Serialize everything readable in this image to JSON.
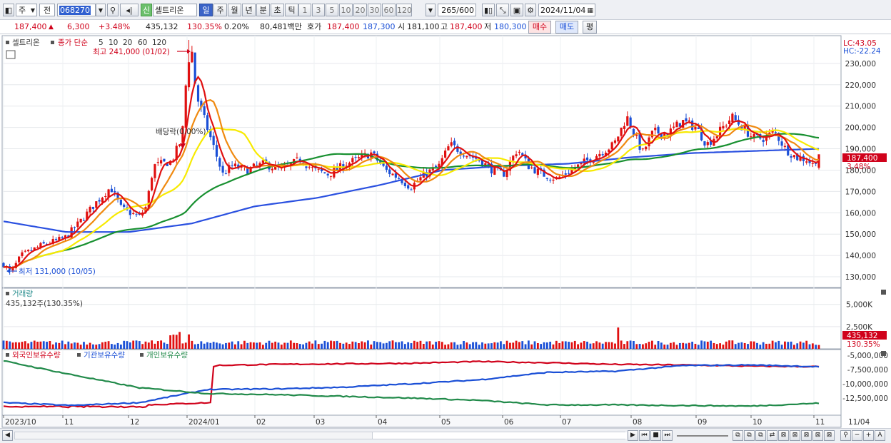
{
  "toolbar": {
    "period_select": "주",
    "compare_select": "전",
    "code": "068270",
    "new_badge": "신",
    "stock_name": "셀트리온",
    "period_tabs": [
      "일",
      "주",
      "월",
      "년",
      "분",
      "초",
      "틱"
    ],
    "active_period": "일",
    "interval_buttons": [
      "1",
      "3",
      "5",
      "10",
      "20",
      "30",
      "60",
      "120"
    ],
    "count": "265",
    "count_total": "/600",
    "date": "2024/11/04"
  },
  "quote": {
    "price": "187,400",
    "arrow": "▲",
    "change": "6,300",
    "change_pct": "+3.48%",
    "volume": "435,132",
    "volume_ratio": "130.35%",
    "turnover": "0.20%",
    "amount": "80,481백만",
    "bid_label": "호가",
    "ask": "187,400",
    "bid": "187,300",
    "open_label": "시",
    "open": "181,100",
    "high_label": "고",
    "high": "187,400",
    "low_label": "저",
    "low": "180,300",
    "buy_btn": "매수",
    "sell_btn": "매도",
    "eval_btn": "평"
  },
  "price_panel": {
    "stock_label": "셀트리온",
    "ma_label": "종가 단순",
    "ma_periods": [
      "5",
      "10",
      "20",
      "60",
      "120"
    ],
    "ma_colors": [
      "#e01010",
      "#f08a10",
      "#f7ea00",
      "#189030",
      "#2a50e0"
    ],
    "lc": "LC:43.05",
    "hc": "HC:-22.24",
    "high_note": "최고 241,000 (01/02)",
    "low_note": "최저 131,000 (10/05)",
    "dividend_note": "배당락(0.00%)",
    "price_tag": "187,400",
    "pct_tag": "3.48%",
    "y_ticks": [
      "230,000",
      "220,000",
      "210,000",
      "200,000",
      "190,000",
      "180,000",
      "170,000",
      "160,000",
      "150,000",
      "140,000",
      "130,000"
    ]
  },
  "volume_panel": {
    "title": "거래량",
    "value": "435,132주(130.35%)",
    "y_ticks": [
      "5,000K",
      "2,500K"
    ],
    "tag": "435,132",
    "tag_pct": "130.35%"
  },
  "holdings_panel": {
    "legend": [
      "외국인보유수량",
      "기관보유수량",
      "개인보유수량"
    ],
    "colors": [
      "#d0021b",
      "#1a4fd6",
      "#218a4a"
    ],
    "y_ticks": [
      "-5,000,000",
      "-7,500,000",
      "-10,000,000",
      "-12,500,000"
    ]
  },
  "x_axis": {
    "labels": [
      "2023/10",
      "11",
      "12",
      "2024/01",
      "02",
      "03",
      "04",
      "05",
      "06",
      "07",
      "08",
      "09",
      "10",
      "11"
    ],
    "right_label": "11/04"
  },
  "chart_data": [
    {
      "type": "line",
      "name": "price",
      "x": [
        "2023/10",
        "11",
        "12",
        "2024/01",
        "02",
        "03",
        "04",
        "05",
        "06",
        "07",
        "08",
        "09",
        "10",
        "11"
      ],
      "series": [
        {
          "name": "5",
          "values": [
            136000,
            147000,
            160000,
            226000,
            182000,
            183000,
            178000,
            192000,
            180000,
            178000,
            198000,
            201000,
            198000,
            187400
          ]
        },
        {
          "name": "120",
          "values": [
            156000,
            151000,
            151000,
            155000,
            163000,
            167000,
            173000,
            180000,
            182000,
            183000,
            186000,
            188000,
            189000,
            190000
          ]
        }
      ],
      "ylim": [
        125000,
        243000
      ],
      "high": 241000,
      "low": 131000
    },
    {
      "type": "bar",
      "name": "volume",
      "last_value": 435132,
      "ylim": [
        0,
        6500000
      ]
    },
    {
      "type": "line",
      "name": "holdings",
      "series": [
        {
          "name": "외국인보유수량",
          "values": [
            -14000000,
            -13800000,
            -13700000,
            -6800000,
            -6600000,
            -6500000,
            -6400000,
            -6100000,
            -6300000,
            -6600000,
            -6700000,
            -6900000,
            -7000000
          ]
        },
        {
          "name": "기관보유수량",
          "values": [
            -13300000,
            -13800000,
            -13300000,
            -11000000,
            -10900000,
            -10600000,
            -10000000,
            -9300000,
            -8000000,
            -7800000,
            -6800000,
            -6700000,
            -7000000
          ]
        },
        {
          "name": "개인보유수량",
          "values": [
            -6000000,
            -8400000,
            -10700000,
            -11700000,
            -11900000,
            -12200000,
            -12500000,
            -12900000,
            -13700000,
            -13700000,
            -13800000,
            -13900000,
            -13400000
          ]
        }
      ],
      "ylim": [
        -15500000,
        -4000000
      ]
    }
  ]
}
